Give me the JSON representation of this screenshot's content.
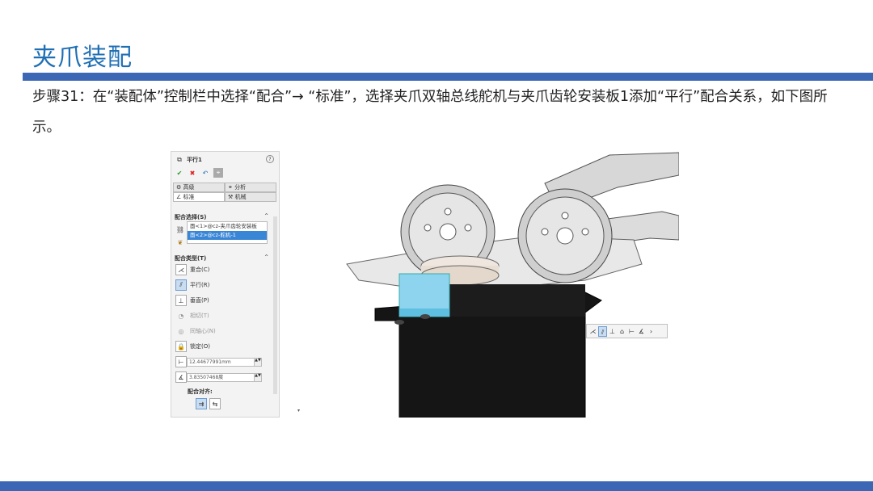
{
  "slide": {
    "title": "夹爪装配",
    "description": "步骤31：在“装配体”控制栏中选择“配合”→ “标准”，选择夹爪双轴总线舵机与夹爪齿轮安装板1添加“平行”配合关系，如下图所示。"
  },
  "panel": {
    "title": "平行1",
    "help_icon": "?",
    "actions": {
      "ok": "✔",
      "cancel": "✖",
      "undo": "↶",
      "pin": "⌖"
    },
    "tabs": [
      {
        "label": "高级",
        "icon": "gear-icon"
      },
      {
        "label": "分析",
        "icon": "link-icon"
      },
      {
        "label": "标准",
        "icon": "angle-icon"
      },
      {
        "label": "机械",
        "icon": "wrench-icon"
      }
    ],
    "mate_selection": {
      "heading": "配合选择(S)",
      "items": [
        "面<1>@cz-夹爪齿轮安装板",
        "面<2>@cz-舵机-1"
      ]
    },
    "mate_types": {
      "heading": "配合类型(T)",
      "items": [
        {
          "label": "重合(C)",
          "enabled": true,
          "selected": false
        },
        {
          "label": "平行(R)",
          "enabled": true,
          "selected": true
        },
        {
          "label": "垂直(P)",
          "enabled": true,
          "selected": false
        },
        {
          "label": "相切(T)",
          "enabled": false,
          "selected": false
        },
        {
          "label": "同轴心(N)",
          "enabled": false,
          "selected": false
        },
        {
          "label": "锁定(O)",
          "enabled": true,
          "selected": false
        }
      ]
    },
    "distance_value": "12.44677991mm",
    "angle_value": "3.83507468度",
    "alignment_label": "配合对齐:"
  },
  "mini_toolbar": {
    "buttons": [
      "coincident-icon",
      "parallel-icon",
      "perpendicular-icon",
      "lock-icon",
      "distance-icon",
      "angle-icon"
    ]
  },
  "colors": {
    "accent_blue": "#3b67b5",
    "title_blue": "#1f6fb5",
    "selection_highlight": "#3a86d6",
    "selected_face": "#8fd4ee"
  }
}
